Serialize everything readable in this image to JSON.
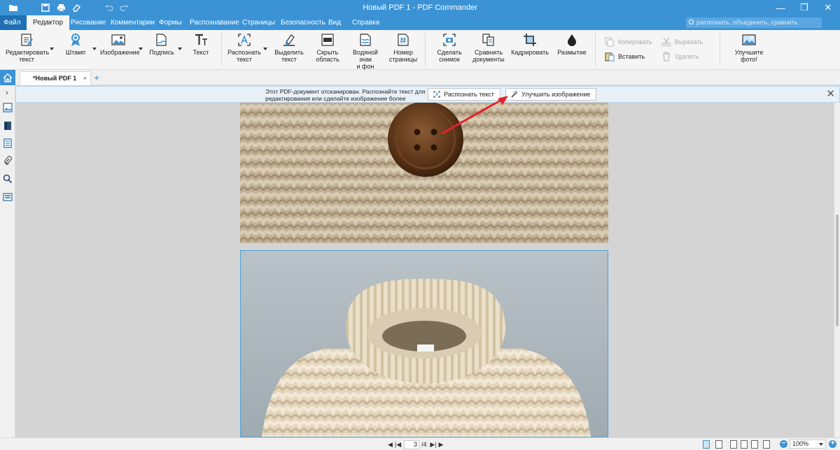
{
  "window": {
    "title": "Новый PDF 1 - PDF Commander",
    "minimize": "—",
    "restore": "❐",
    "close": "✕"
  },
  "menu": {
    "file_label": "Файл",
    "tabs": [
      "Редактор",
      "Рисование",
      "Комментарии",
      "Формы",
      "Распознавание",
      "Страницы",
      "Безопасность",
      "Вид",
      "Справка"
    ],
    "active_tab": "Редактор",
    "search_placeholder": "распознать, объединить, сравнить"
  },
  "ribbon": {
    "edit_text": [
      "Редактировать",
      "текст"
    ],
    "stamp": "Штамп",
    "image": "Изображение",
    "signature": "Подпись",
    "text": "Текст",
    "recognize_text": [
      "Распознать",
      "текст"
    ],
    "select_text": [
      "Выделить",
      "текст"
    ],
    "hide_area": [
      "Скрыть",
      "область"
    ],
    "watermark": [
      "Водяной знак",
      "и фон"
    ],
    "page_number": [
      "Номер",
      "страницы"
    ],
    "snapshot": [
      "Сделать",
      "снимок"
    ],
    "compare": [
      "Сравнить",
      "документы"
    ],
    "crop": "Кадрировать",
    "blur": "Размытие",
    "copy": "Копировать",
    "paste": "Вставить",
    "cut": "Вырезать",
    "delete": "Удалить",
    "improve_photo": "Улучшите фото!"
  },
  "doc_tabs": {
    "active_name": "*Новый PDF 1",
    "close": "×",
    "add": "+"
  },
  "notice": {
    "message_line1": "Этот PDF-документ отсканирован. Распознайте текст для",
    "message_line2": "редактирования или сделайте изображение более четким.",
    "recognize_button": "Распознать текст",
    "enhance_button": "Улучшить изображение",
    "close": "✕"
  },
  "status": {
    "current_page": "3",
    "total_pages": "/4",
    "zoom": "100%",
    "zoom_out": "−",
    "zoom_in": "+"
  },
  "colors": {
    "accent": "#3b93d6",
    "arrow": "#e3222b"
  }
}
